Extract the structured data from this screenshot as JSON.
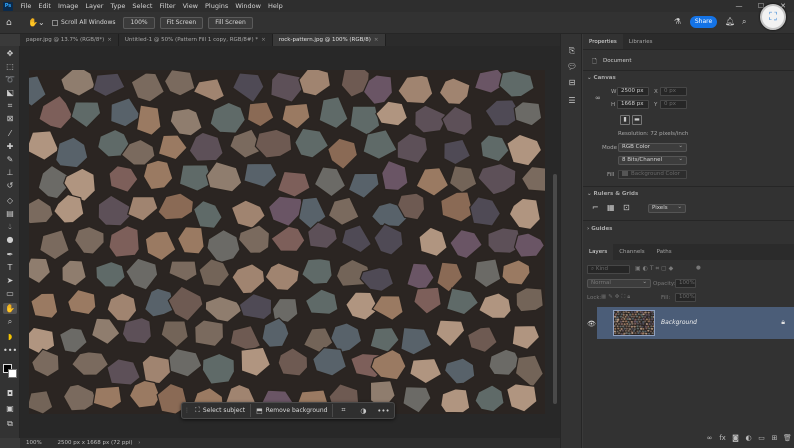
{
  "app": {
    "logo": "Ps"
  },
  "menu": [
    "File",
    "Edit",
    "Image",
    "Layer",
    "Type",
    "Select",
    "Filter",
    "View",
    "Plugins",
    "Window",
    "Help"
  ],
  "window_controls": [
    "—",
    "☐",
    "✕"
  ],
  "options_bar": {
    "scroll_all_windows": "Scroll All Windows",
    "zoom": "100%",
    "fit_screen": "Fit Screen",
    "fill_screen": "Fill Screen",
    "share": "Share"
  },
  "tabs": [
    {
      "label": "paper.jpg @ 13.7% (RGB/8*)",
      "active": false
    },
    {
      "label": "Untitled-1 @ 50% (Pattern Fill 1 copy, RGB/8#) *",
      "active": false
    },
    {
      "label": "rock-pattern.jpg @ 100% (RGB/8)",
      "active": true
    }
  ],
  "context_bar": {
    "select_subject": "Select subject",
    "remove_background": "Remove background",
    "more": "•••"
  },
  "status_bar": {
    "zoom": "100%",
    "info": "2500 px x 1668 px (72 ppi)"
  },
  "properties": {
    "tabs": [
      "Properties",
      "Libraries"
    ],
    "document_label": "Document",
    "canvas_header": "Canvas",
    "w_label": "W",
    "w_value": "2500 px",
    "h_label": "H",
    "h_value": "1668 px",
    "x_label": "X",
    "x_value": "0 px",
    "y_label": "Y",
    "y_value": "0 px",
    "resolution": "Resolution: 72 pixels/inch",
    "mode_label": "Mode",
    "mode_value": "RGB Color",
    "bits_value": "8 Bits/Channel",
    "fill_label": "Fill",
    "fill_value": "Background Color",
    "rulers_header": "Rulers & Grids",
    "units_value": "Pixels",
    "guides_header": "Guides"
  },
  "layers": {
    "tabs": [
      "Layers",
      "Channels",
      "Paths"
    ],
    "kind_placeholder": "Kind",
    "blend_mode": "Normal",
    "opacity_label": "Opacity:",
    "opacity_value": "100%",
    "lock_label": "Lock:",
    "fill_label": "Fill:",
    "fill_value": "100%",
    "layer_name": "Background"
  },
  "colors": {
    "accent": "#1473e6",
    "layer_selected": "#4b5d78"
  }
}
